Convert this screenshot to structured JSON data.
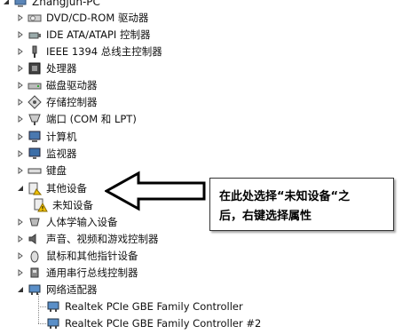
{
  "root": {
    "label": "Zhangjun-PC"
  },
  "devices": [
    {
      "label": "DVD/CD-ROM 驱动器",
      "icon": "dvd-drive-icon",
      "expanded": false
    },
    {
      "label": "IDE ATA/ATAPI 控制器",
      "icon": "ide-controller-icon",
      "expanded": false
    },
    {
      "label": "IEEE 1394 总线主控制器",
      "icon": "ieee1394-icon",
      "expanded": false
    },
    {
      "label": "处理器",
      "icon": "processor-icon",
      "expanded": false
    },
    {
      "label": "磁盘驱动器",
      "icon": "disk-drive-icon",
      "expanded": false
    },
    {
      "label": "存储控制器",
      "icon": "storage-controller-icon",
      "expanded": false
    },
    {
      "label": "端口 (COM 和 LPT)",
      "icon": "port-icon",
      "expanded": false
    },
    {
      "label": "计算机",
      "icon": "computer-icon",
      "expanded": false
    },
    {
      "label": "监视器",
      "icon": "monitor-icon",
      "expanded": false
    },
    {
      "label": "键盘",
      "icon": "keyboard-icon",
      "expanded": false
    },
    {
      "label": "其他设备",
      "icon": "other-devices-icon",
      "expanded": true,
      "children": [
        {
          "label": "未知设备",
          "icon": "unknown-device-warning-icon"
        }
      ]
    },
    {
      "label": "人体学输入设备",
      "icon": "hid-icon",
      "expanded": false
    },
    {
      "label": "声音、视频和游戏控制器",
      "icon": "sound-icon",
      "expanded": false
    },
    {
      "label": "鼠标和其他指针设备",
      "icon": "mouse-icon",
      "expanded": false
    },
    {
      "label": "通用串行总线控制器",
      "icon": "usb-icon",
      "expanded": false
    },
    {
      "label": "网络适配器",
      "icon": "network-adapter-icon",
      "expanded": true,
      "children": [
        {
          "label": "Realtek PCIe GBE Family Controller",
          "icon": "network-card-icon"
        },
        {
          "label": "Realtek PCIe GBE Family Controller #2",
          "icon": "network-card-icon"
        }
      ]
    }
  ],
  "callout": {
    "line1": "在此处选择“未知设备“之",
    "line2": "后，右键选择属性",
    "arrow_icon": "left-arrow-icon"
  }
}
